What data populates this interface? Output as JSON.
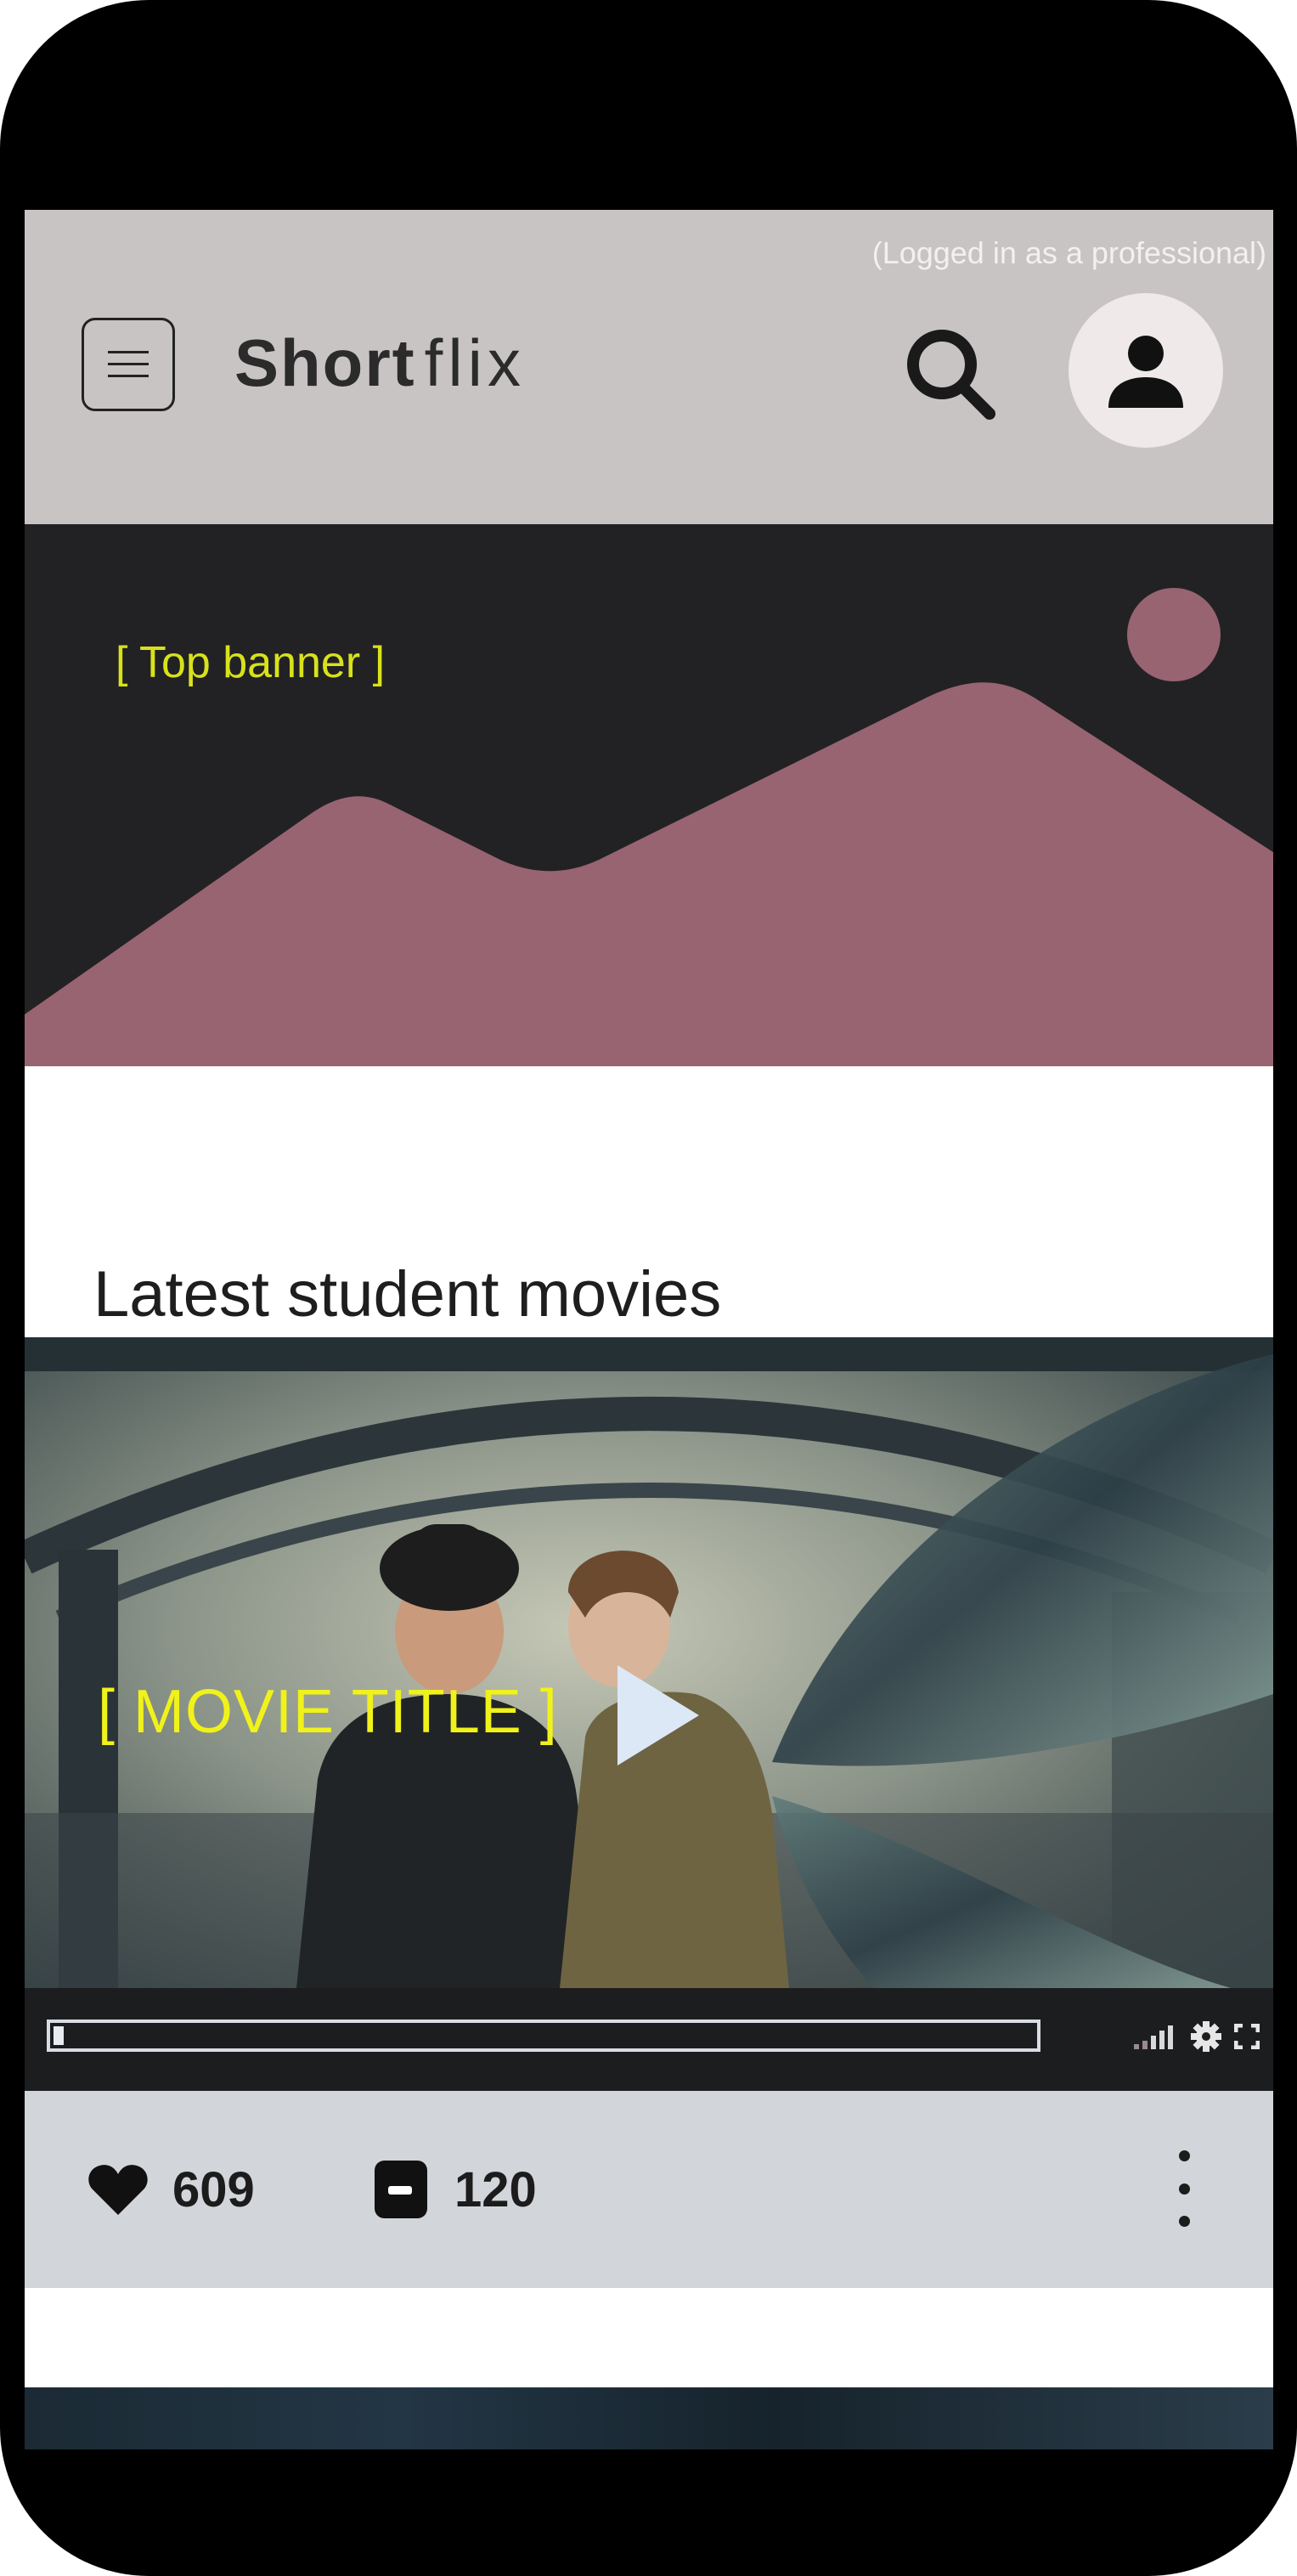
{
  "header": {
    "login_status": "(Logged in as a professional)",
    "logo_bold": "Short",
    "logo_light": "flix",
    "icons": [
      "menu-icon",
      "search-icon",
      "user-icon"
    ]
  },
  "banner": {
    "label": "[ Top banner ]",
    "colors": {
      "background": "#222224",
      "mountains": "#986471"
    }
  },
  "section": {
    "title": "Latest student movies"
  },
  "video": {
    "title": "[ MOVIE TITLE ]",
    "progress": 0.01,
    "control_icons": [
      "signal-icon",
      "settings-icon",
      "fullscreen-icon"
    ]
  },
  "actions": {
    "likes": "609",
    "comments": "120",
    "icons": [
      "heart-icon",
      "comment-icon",
      "more-vertical-icon"
    ]
  }
}
